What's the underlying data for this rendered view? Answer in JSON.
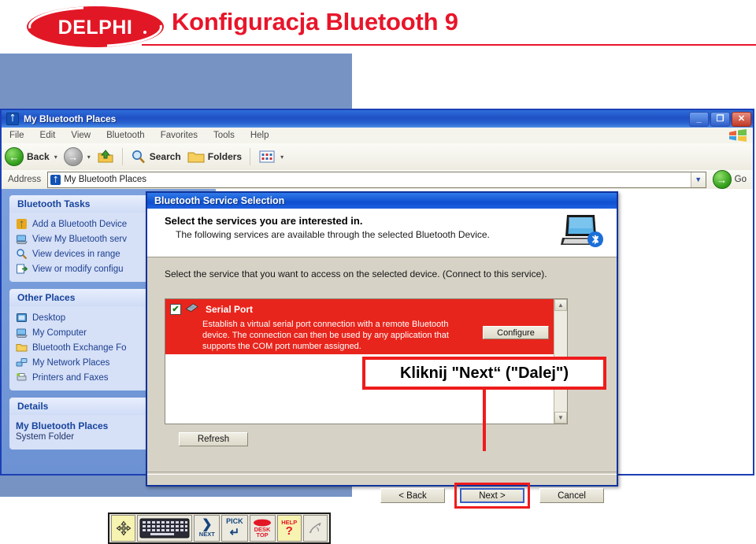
{
  "slide": {
    "logo_text": "DELPHI",
    "title": "Konfiguracja Bluetooth 9"
  },
  "explorer": {
    "title": "My Bluetooth Places",
    "title_icon": "bluetooth-icon",
    "window_buttons": {
      "minimize": "_",
      "maximize": "❐",
      "close": "✕"
    },
    "menu": [
      "File",
      "Edit",
      "View",
      "Bluetooth",
      "Favorites",
      "Tools",
      "Help"
    ],
    "toolbar": {
      "back_label": "Back",
      "back_icon": "back-arrow-icon",
      "forward_icon": "forward-arrow-icon",
      "up_icon": "up-folder-icon",
      "search_label": "Search",
      "search_icon": "magnifier-icon",
      "folders_label": "Folders",
      "folders_icon": "folder-icon",
      "views_icon": "views-icon",
      "caret": "▾"
    },
    "address": {
      "label": "Address",
      "value": "My Bluetooth Places",
      "icon": "bluetooth-icon",
      "dropdown_icon": "chevron-down-icon",
      "go_label": "Go",
      "go_icon": "go-arrow-icon"
    }
  },
  "sidebar": {
    "panels": [
      {
        "title": "Bluetooth Tasks",
        "items": [
          {
            "label": "Add a Bluetooth Device",
            "icon": "bluetooth-device-icon"
          },
          {
            "label": "View My Bluetooth serv",
            "icon": "computer-icon"
          },
          {
            "label": "View devices in range",
            "icon": "magnifier-icon"
          },
          {
            "label": "View or modify configu",
            "icon": "configure-icon"
          }
        ]
      },
      {
        "title": "Other Places",
        "items": [
          {
            "label": "Desktop",
            "icon": "desktop-icon"
          },
          {
            "label": "My Computer",
            "icon": "computer-icon"
          },
          {
            "label": "Bluetooth Exchange Fo",
            "icon": "folder-icon"
          },
          {
            "label": "My Network Places",
            "icon": "network-icon"
          },
          {
            "label": "Printers and Faxes",
            "icon": "printer-icon"
          }
        ]
      }
    ],
    "details": {
      "title": "Details",
      "name": "My Bluetooth Places",
      "type": "System Folder"
    }
  },
  "dialog": {
    "title": "Bluetooth Service Selection",
    "heading": "Select the services you are interested in.",
    "subheading": "The following services are available through the selected Bluetooth Device.",
    "banner_icon": "laptop-bluetooth-icon",
    "instruction": "Select the service that you want to access on the selected device. (Connect to this service).",
    "service": {
      "checked": true,
      "check_glyph": "✔",
      "icon": "serial-port-icon",
      "name": "Serial Port",
      "description": "Establish a virtual serial port connection with a remote Bluetooth device. The connection can then be used by any application that supports the COM port number assigned.",
      "configure_label": "Configure",
      "highlight_color": "#e8251c"
    },
    "scrollbar": {
      "up_glyph": "▲",
      "down_glyph": "▼"
    },
    "refresh_label": "Refresh",
    "buttons": {
      "back": "< Back",
      "next": "Next >",
      "cancel": "Cancel"
    }
  },
  "callout": {
    "text": "Kliknij \"Next“ (\"Dalej\")",
    "border_color": "#ee1c1c"
  },
  "navbar": {
    "buttons": [
      {
        "name": "pan-button",
        "icon": "four-way-arrow-icon",
        "label": ""
      },
      {
        "name": "keyboard-button",
        "icon": "keyboard-icon",
        "label": ""
      },
      {
        "name": "next-button",
        "icon": "chevron-right-icon",
        "label": "NEXT"
      },
      {
        "name": "pick-button",
        "icon": "enter-arrow-icon",
        "label": "PICK"
      },
      {
        "name": "desktop-button",
        "icon": "desktop-ellipse-icon",
        "label_top": "DESK",
        "label_bottom": "TOP"
      },
      {
        "name": "help-button",
        "icon": "question-mark-icon",
        "label": "HELP"
      },
      {
        "name": "pointer-button",
        "icon": "pointer-icon",
        "label": ""
      }
    ]
  }
}
